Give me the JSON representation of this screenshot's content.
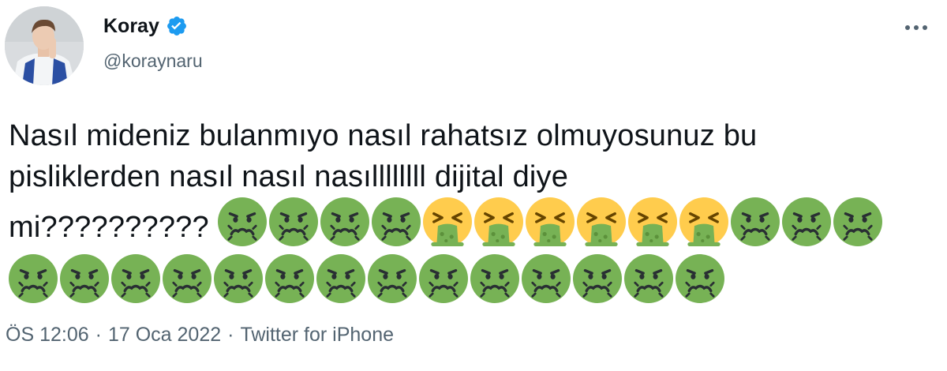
{
  "author": {
    "display_name": "Koray",
    "handle": "@koraynaru",
    "verified": true,
    "avatar_icon": "profile-photo",
    "verified_color": "#1d9bf0"
  },
  "more_icon": "more-horizontal-icon",
  "tweet": {
    "line1": "Nasıl mideniz bulanmıyo nasıl rahatsız olmuyosunuz bu",
    "line2": "pisliklerden nasıl nasıl nasıllllllll dijital diye",
    "line3": "mi??????????",
    "emojis_line3": [
      "nauseated-face",
      "nauseated-face",
      "nauseated-face",
      "nauseated-face",
      "vomiting-face",
      "vomiting-face",
      "vomiting-face",
      "vomiting-face",
      "vomiting-face",
      "vomiting-face",
      "nauseated-face",
      "nauseated-face",
      "nauseated-face"
    ],
    "emojis_line4": [
      "nauseated-face",
      "nauseated-face",
      "nauseated-face",
      "nauseated-face",
      "nauseated-face",
      "nauseated-face",
      "nauseated-face",
      "nauseated-face",
      "nauseated-face",
      "nauseated-face",
      "nauseated-face",
      "nauseated-face",
      "nauseated-face",
      "nauseated-face"
    ]
  },
  "meta": {
    "time": "ÖS 12:06",
    "separator": "·",
    "date": "17 Oca 2022",
    "source": "Twitter for iPhone"
  },
  "colors": {
    "text": "#0f1419",
    "secondary": "#536471",
    "nauseated": "#77b255",
    "vomiting_face": "#ffcc4d"
  }
}
